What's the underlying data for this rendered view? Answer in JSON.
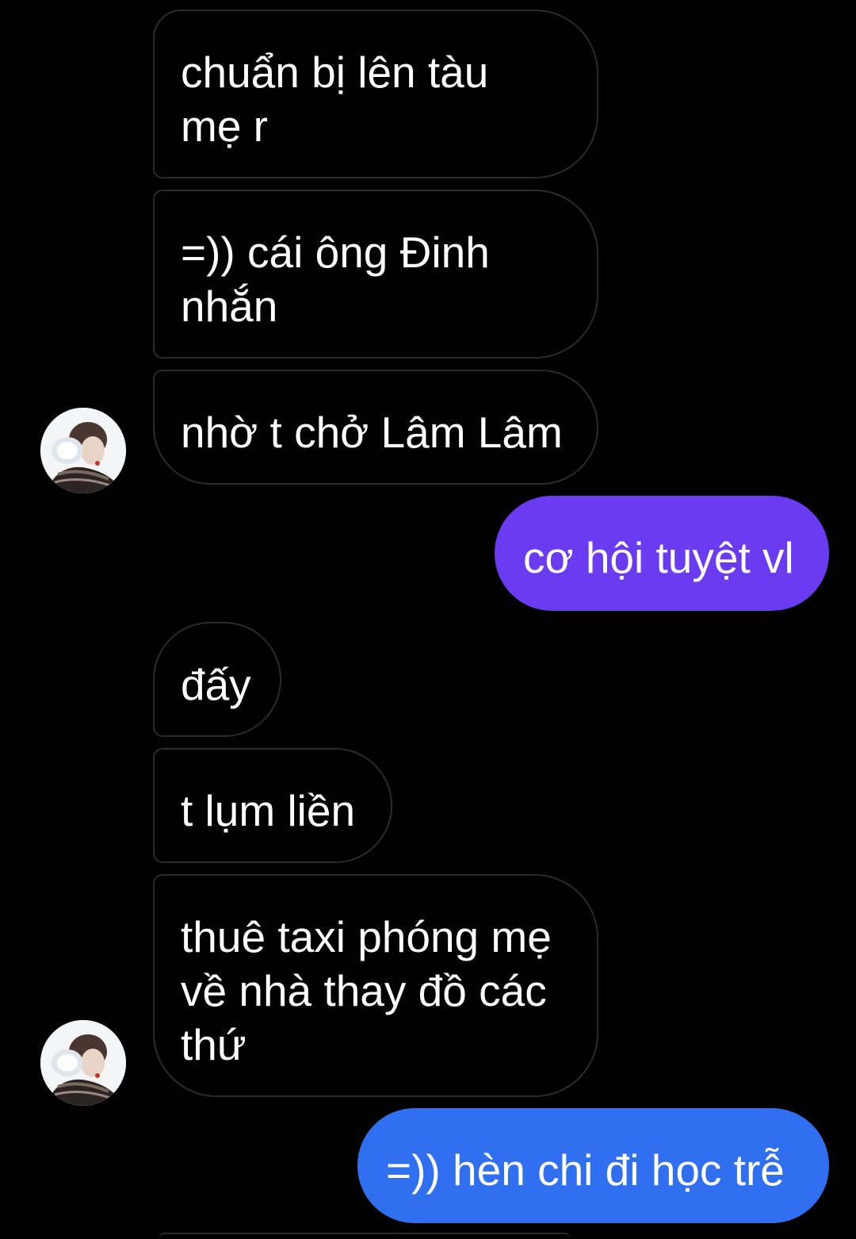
{
  "chat": {
    "messages": [
      {
        "sender": "other",
        "lines": [
          "chuẩn bị lên tàu",
          "mẹ r"
        ]
      },
      {
        "sender": "other",
        "lines": [
          "=)) cái ông Đinh",
          "nhắn"
        ]
      },
      {
        "sender": "other",
        "lines": [
          "nhờ t chở Lâm Lâm"
        ]
      },
      {
        "sender": "me",
        "lines": [
          "cơ hội tuyệt vl"
        ]
      },
      {
        "sender": "other",
        "lines": [
          "đấy"
        ]
      },
      {
        "sender": "other",
        "lines": [
          "t lụm liền"
        ]
      },
      {
        "sender": "other",
        "lines": [
          "thuê taxi phóng mẹ",
          "về nhà thay đồ các",
          "thứ"
        ]
      },
      {
        "sender": "me",
        "lines": [
          "=)) hèn chi đi học trễ"
        ]
      }
    ]
  },
  "colors": {
    "background": "#000000",
    "incoming_border": "#2b2b2b",
    "outgoing_purple": "#6a3bf0",
    "outgoing_blue": "#2f6ff0",
    "text": "#ffffff"
  },
  "icons": {
    "avatar": "contact-avatar-photo"
  }
}
